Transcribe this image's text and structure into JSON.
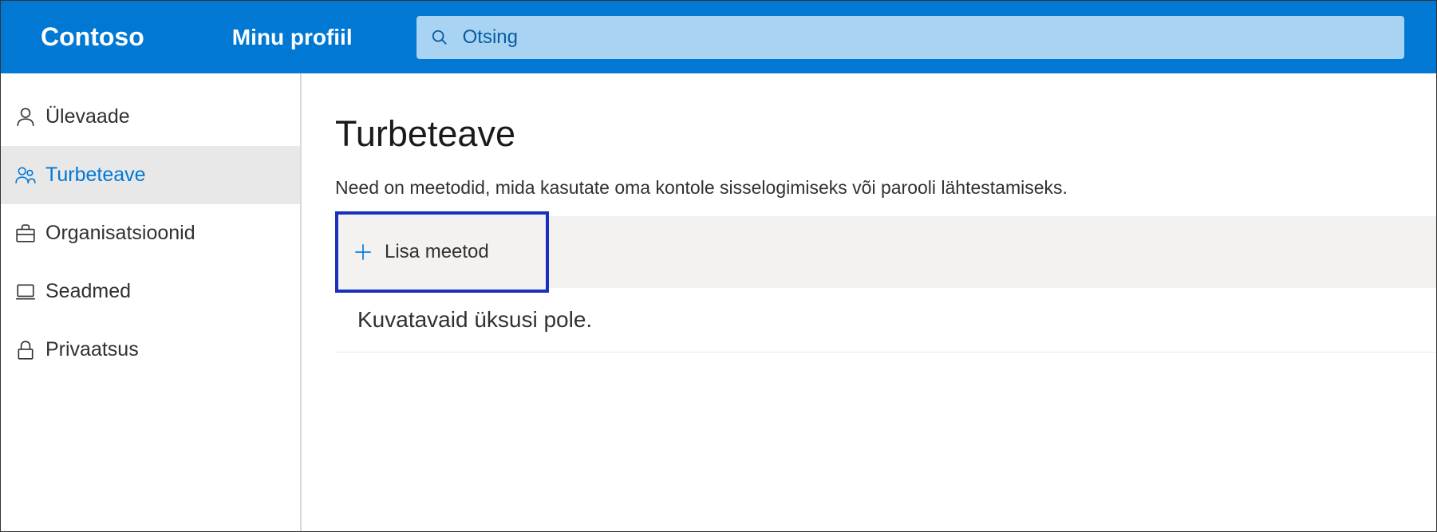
{
  "header": {
    "brand": "Contoso",
    "profile_link": "Minu profiil",
    "search_placeholder": "Otsing"
  },
  "sidebar": {
    "items": [
      {
        "label": "Ülevaade",
        "icon": "person"
      },
      {
        "label": "Turbeteave",
        "icon": "people"
      },
      {
        "label": "Organisatsioonid",
        "icon": "briefcase"
      },
      {
        "label": "Seadmed",
        "icon": "laptop"
      },
      {
        "label": "Privaatsus",
        "icon": "lock"
      }
    ]
  },
  "main": {
    "title": "Turbeteave",
    "description": "Need on meetodid, mida kasutate oma kontole sisselogimiseks või parooli lähtestamiseks.",
    "add_method_label": "Lisa meetod",
    "empty_message": "Kuvatavaid üksusi pole."
  }
}
